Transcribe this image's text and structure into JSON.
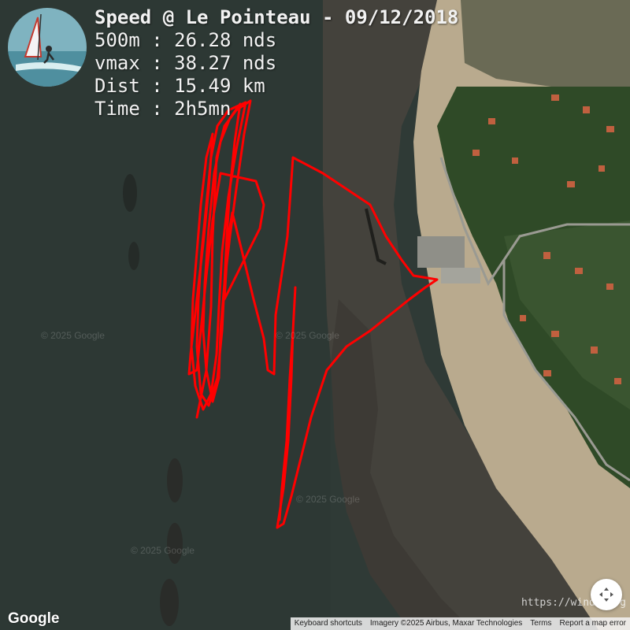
{
  "map": {
    "colors": {
      "track": "#ff0000",
      "water": "#2f3a36",
      "sand": "#b9aa8e",
      "forest": "#2f4a27",
      "roofs": "#c0603f"
    },
    "icons": [
      "windsurfer-avatar",
      "compass-arrows-icon"
    ]
  },
  "session": {
    "title": "Speed @ Le Pointeau - 09/12/2018",
    "speed_500m": "500m : 26.28 nds",
    "vmax": "vmax : 38.27 nds",
    "distance": "Dist : 15.49 km",
    "time": "Time : 2h5mn"
  },
  "watermarks": [
    "© 2025 Google",
    "© 2025 Google",
    "© 2025 Google",
    "© 2025 Google"
  ],
  "branding": {
    "google": "Google",
    "site_url": "https://windr.org"
  },
  "attribution": {
    "keyboard_shortcuts": "Keyboard shortcuts",
    "imagery": "Imagery ©2025 Airbus, Maxar Technologies",
    "terms": "Terms",
    "report": "Report a map error"
  }
}
